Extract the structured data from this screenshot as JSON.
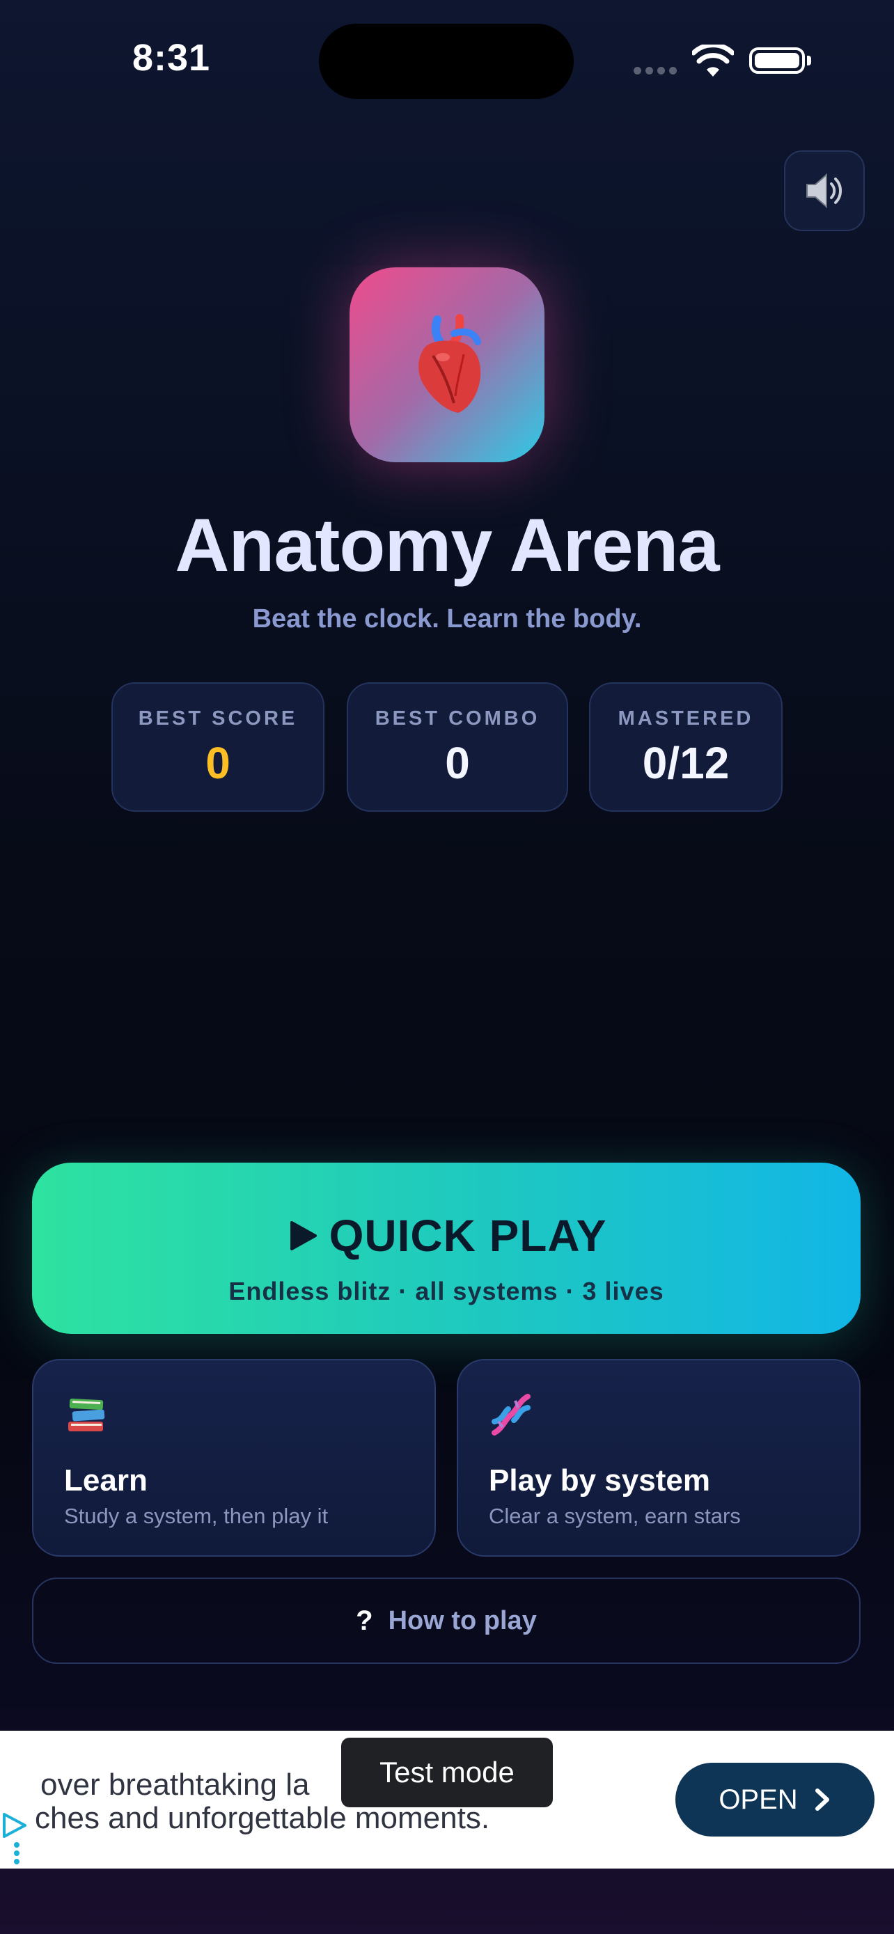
{
  "status_bar": {
    "time": "8:31"
  },
  "app": {
    "title": "Anatomy Arena",
    "tagline": "Beat the clock. Learn the body.",
    "icon": "anatomical-heart-icon"
  },
  "stats": [
    {
      "label": "BEST SCORE",
      "value": "0",
      "color": "#fbbf24"
    },
    {
      "label": "BEST COMBO",
      "value": "0",
      "color": "#f3f5ff"
    },
    {
      "label": "MASTERED",
      "value": "0/12",
      "color": "#f3f5ff"
    }
  ],
  "quick_play": {
    "label": "QUICK PLAY",
    "subtitle": "Endless blitz · all systems · 3 lives"
  },
  "modes": [
    {
      "title": "Learn",
      "subtitle": "Study a system, then play it",
      "icon": "books-icon"
    },
    {
      "title": "Play by system",
      "subtitle": "Clear a system, earn stars",
      "icon": "dna-icon"
    }
  ],
  "how_to_play": {
    "label": "How to play"
  },
  "ad": {
    "line1": "over breathtaking la",
    "line2": "ches and unforgettable moments.",
    "cta": "OPEN",
    "toast": "Test mode"
  },
  "colors": {
    "accent_start": "#2ee2a0",
    "accent_end": "#12b6e6",
    "gold": "#fbbf24",
    "ad_button": "#0f3556"
  }
}
